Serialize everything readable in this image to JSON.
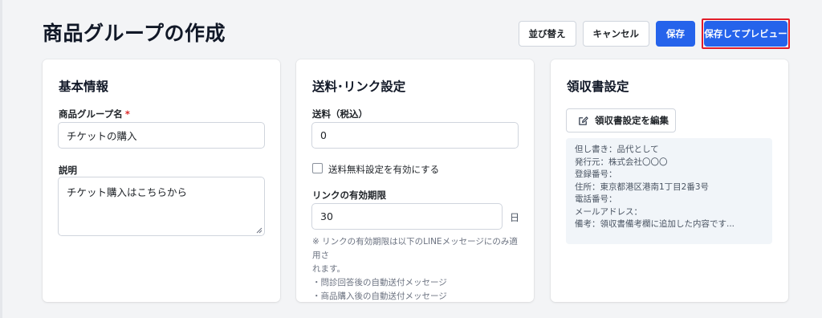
{
  "page": {
    "title": "商品グループの作成"
  },
  "toolbar": {
    "reorder_label": "並び替え",
    "cancel_label": "キャンセル",
    "save_label": "保存",
    "save_preview_label": "保存してプレビュー"
  },
  "basic_info": {
    "title": "基本情報",
    "group_name_label": "商品グループ名",
    "required_mark": "*",
    "group_name_value": "チケットの購入",
    "description_label": "説明",
    "description_value": "チケット購入はこちらから"
  },
  "shipping": {
    "title": "送料･リンク設定",
    "fee_label": "送料（税込）",
    "fee_value": "0",
    "free_shipping_label": "送料無料設定を有効にする",
    "free_shipping_checked": false,
    "link_expiry_label": "リンクの有効期限",
    "link_expiry_value": "30",
    "link_expiry_unit": "日",
    "note_lines": [
      "※ リンクの有効期限は以下のLINEメッセージにのみ適用さ",
      "れます。",
      "・問診回答後の自動送付メッセージ",
      "・商品購入後の自動送付メッセージ"
    ]
  },
  "receipt": {
    "title": "領収書設定",
    "edit_button_label": "領収書設定を編集",
    "preview_lines": [
      "但し書き：品代として",
      "発行元：株式会社〇〇〇",
      "登録番号：",
      "住所：東京都港区港南1丁目2番3号",
      "電話番号：",
      "メールアドレス：",
      "備考：領収書備考欄に追加した内容です..."
    ]
  },
  "colors": {
    "primary": "#2563eb",
    "highlight_border": "#e11d2a",
    "required": "#dc2626",
    "background": "#f3f4f6"
  },
  "icons": {
    "edit": "edit-icon",
    "resize": "resize-grip-icon"
  }
}
